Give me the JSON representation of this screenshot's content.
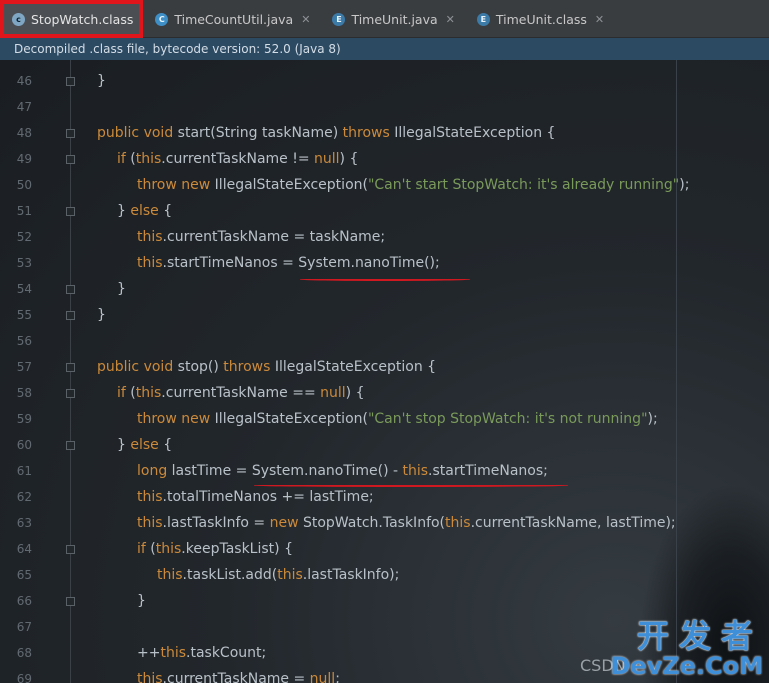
{
  "tabs": [
    {
      "label": "StopWatch.class",
      "icon": "class-file-icon",
      "active": true
    },
    {
      "label": "TimeCountUtil.java",
      "icon": "java-class-icon",
      "active": false
    },
    {
      "label": "TimeUnit.java",
      "icon": "enum-icon",
      "active": false
    },
    {
      "label": "TimeUnit.class",
      "icon": "enum-icon",
      "active": false
    }
  ],
  "infobar": {
    "text": "Decompiled .class file, bytecode version: 52.0 (Java 8)"
  },
  "lines": [
    {
      "n": "46",
      "text": "}"
    },
    {
      "n": "47",
      "text": ""
    },
    {
      "n": "48",
      "text": "public void start(String taskName) throws IllegalStateException {"
    },
    {
      "n": "49",
      "text": "if (this.currentTaskName != null) {"
    },
    {
      "n": "50",
      "text": "throw new IllegalStateException(\"Can't start StopWatch: it's already running\");"
    },
    {
      "n": "51",
      "text": "} else {"
    },
    {
      "n": "52",
      "text": "this.currentTaskName = taskName;"
    },
    {
      "n": "53",
      "text": "this.startTimeNanos = System.nanoTime();"
    },
    {
      "n": "54",
      "text": "}"
    },
    {
      "n": "55",
      "text": "}"
    },
    {
      "n": "56",
      "text": ""
    },
    {
      "n": "57",
      "text": "public void stop() throws IllegalStateException {"
    },
    {
      "n": "58",
      "text": "if (this.currentTaskName == null) {"
    },
    {
      "n": "59",
      "text": "throw new IllegalStateException(\"Can't stop StopWatch: it's not running\");"
    },
    {
      "n": "60",
      "text": "} else {"
    },
    {
      "n": "61",
      "text": "long lastTime = System.nanoTime() - this.startTimeNanos;"
    },
    {
      "n": "62",
      "text": "this.totalTimeNanos += lastTime;"
    },
    {
      "n": "63",
      "text": "this.lastTaskInfo = new StopWatch.TaskInfo(this.currentTaskName, lastTime);"
    },
    {
      "n": "64",
      "text": "if (this.keepTaskList) {"
    },
    {
      "n": "65",
      "text": "this.taskList.add(this.lastTaskInfo);"
    },
    {
      "n": "66",
      "text": "}"
    },
    {
      "n": "67",
      "text": ""
    },
    {
      "n": "68",
      "text": "++this.taskCount;"
    },
    {
      "n": "69",
      "text": "this.currentTaskName = null;"
    }
  ],
  "watermark": {
    "csdn": "CSDN",
    "cn": "开发者",
    "en": "DevZe.CoM"
  },
  "colors": {
    "keyword": "#cc8a3a",
    "string": "#7a9a5a",
    "highlight_box": "#e0151b",
    "underline": "#d01820"
  }
}
